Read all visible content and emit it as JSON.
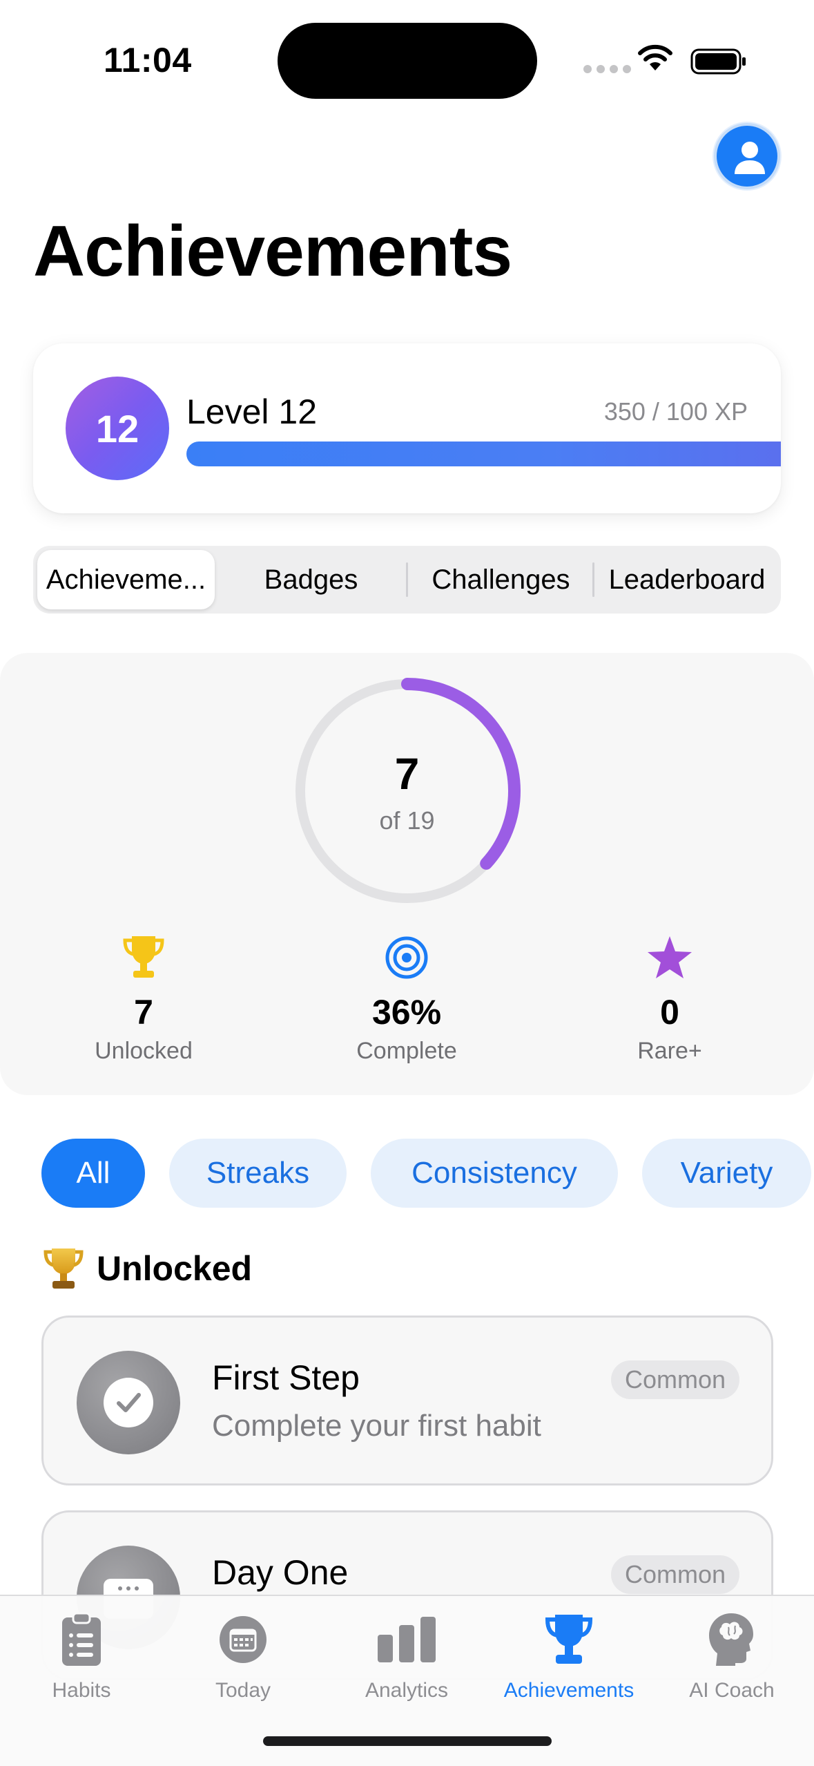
{
  "status_bar": {
    "time": "11:04"
  },
  "header": {
    "title": "Achievements",
    "profile_icon": "person-icon"
  },
  "level_card": {
    "level_number": "12",
    "level_label": "Level 12",
    "xp_text": "350 / 100 XP",
    "xp_progress": 1.0,
    "gradient_colors": [
      "#a35ee2",
      "#5b6cf8"
    ],
    "bar_color": "#3a7ff6"
  },
  "segments": {
    "items": [
      {
        "label": "Achieveme...",
        "active": true
      },
      {
        "label": "Badges",
        "active": false
      },
      {
        "label": "Challenges",
        "active": false
      },
      {
        "label": "Leaderboard",
        "active": false
      }
    ]
  },
  "summary": {
    "unlocked_count": "7",
    "total_text": "of 19",
    "ring_progress": 0.368,
    "ring_color": "#9b5de5",
    "stats": [
      {
        "icon": "trophy-icon",
        "value": "7",
        "label": "Unlocked",
        "color": "#f5c518"
      },
      {
        "icon": "target-icon",
        "value": "36%",
        "label": "Complete",
        "color": "#1a7cf6"
      },
      {
        "icon": "star-icon",
        "value": "0",
        "label": "Rare+",
        "color": "#a24fd9"
      }
    ]
  },
  "filters": {
    "items": [
      {
        "label": "All",
        "active": true
      },
      {
        "label": "Streaks",
        "active": false
      },
      {
        "label": "Consistency",
        "active": false
      },
      {
        "label": "Variety",
        "active": false
      }
    ]
  },
  "section": {
    "title": "Unlocked",
    "icon": "trophy-icon"
  },
  "achievements": [
    {
      "title": "First Step",
      "description": "Complete your first habit",
      "rarity": "Common",
      "icon": "checkmark-icon"
    },
    {
      "title": "Day One",
      "description": "",
      "rarity": "Common",
      "icon": "calendar-icon"
    }
  ],
  "tab_bar": {
    "items": [
      {
        "label": "Habits",
        "icon": "clipboard-list-icon",
        "active": false
      },
      {
        "label": "Today",
        "icon": "calendar-icon",
        "active": false
      },
      {
        "label": "Analytics",
        "icon": "bar-chart-icon",
        "active": false
      },
      {
        "label": "Achievements",
        "icon": "trophy-icon",
        "active": true
      },
      {
        "label": "AI Coach",
        "icon": "brain-head-icon",
        "active": false
      }
    ],
    "active_color": "#1a7cf6",
    "inactive_color": "#8e8e92"
  }
}
